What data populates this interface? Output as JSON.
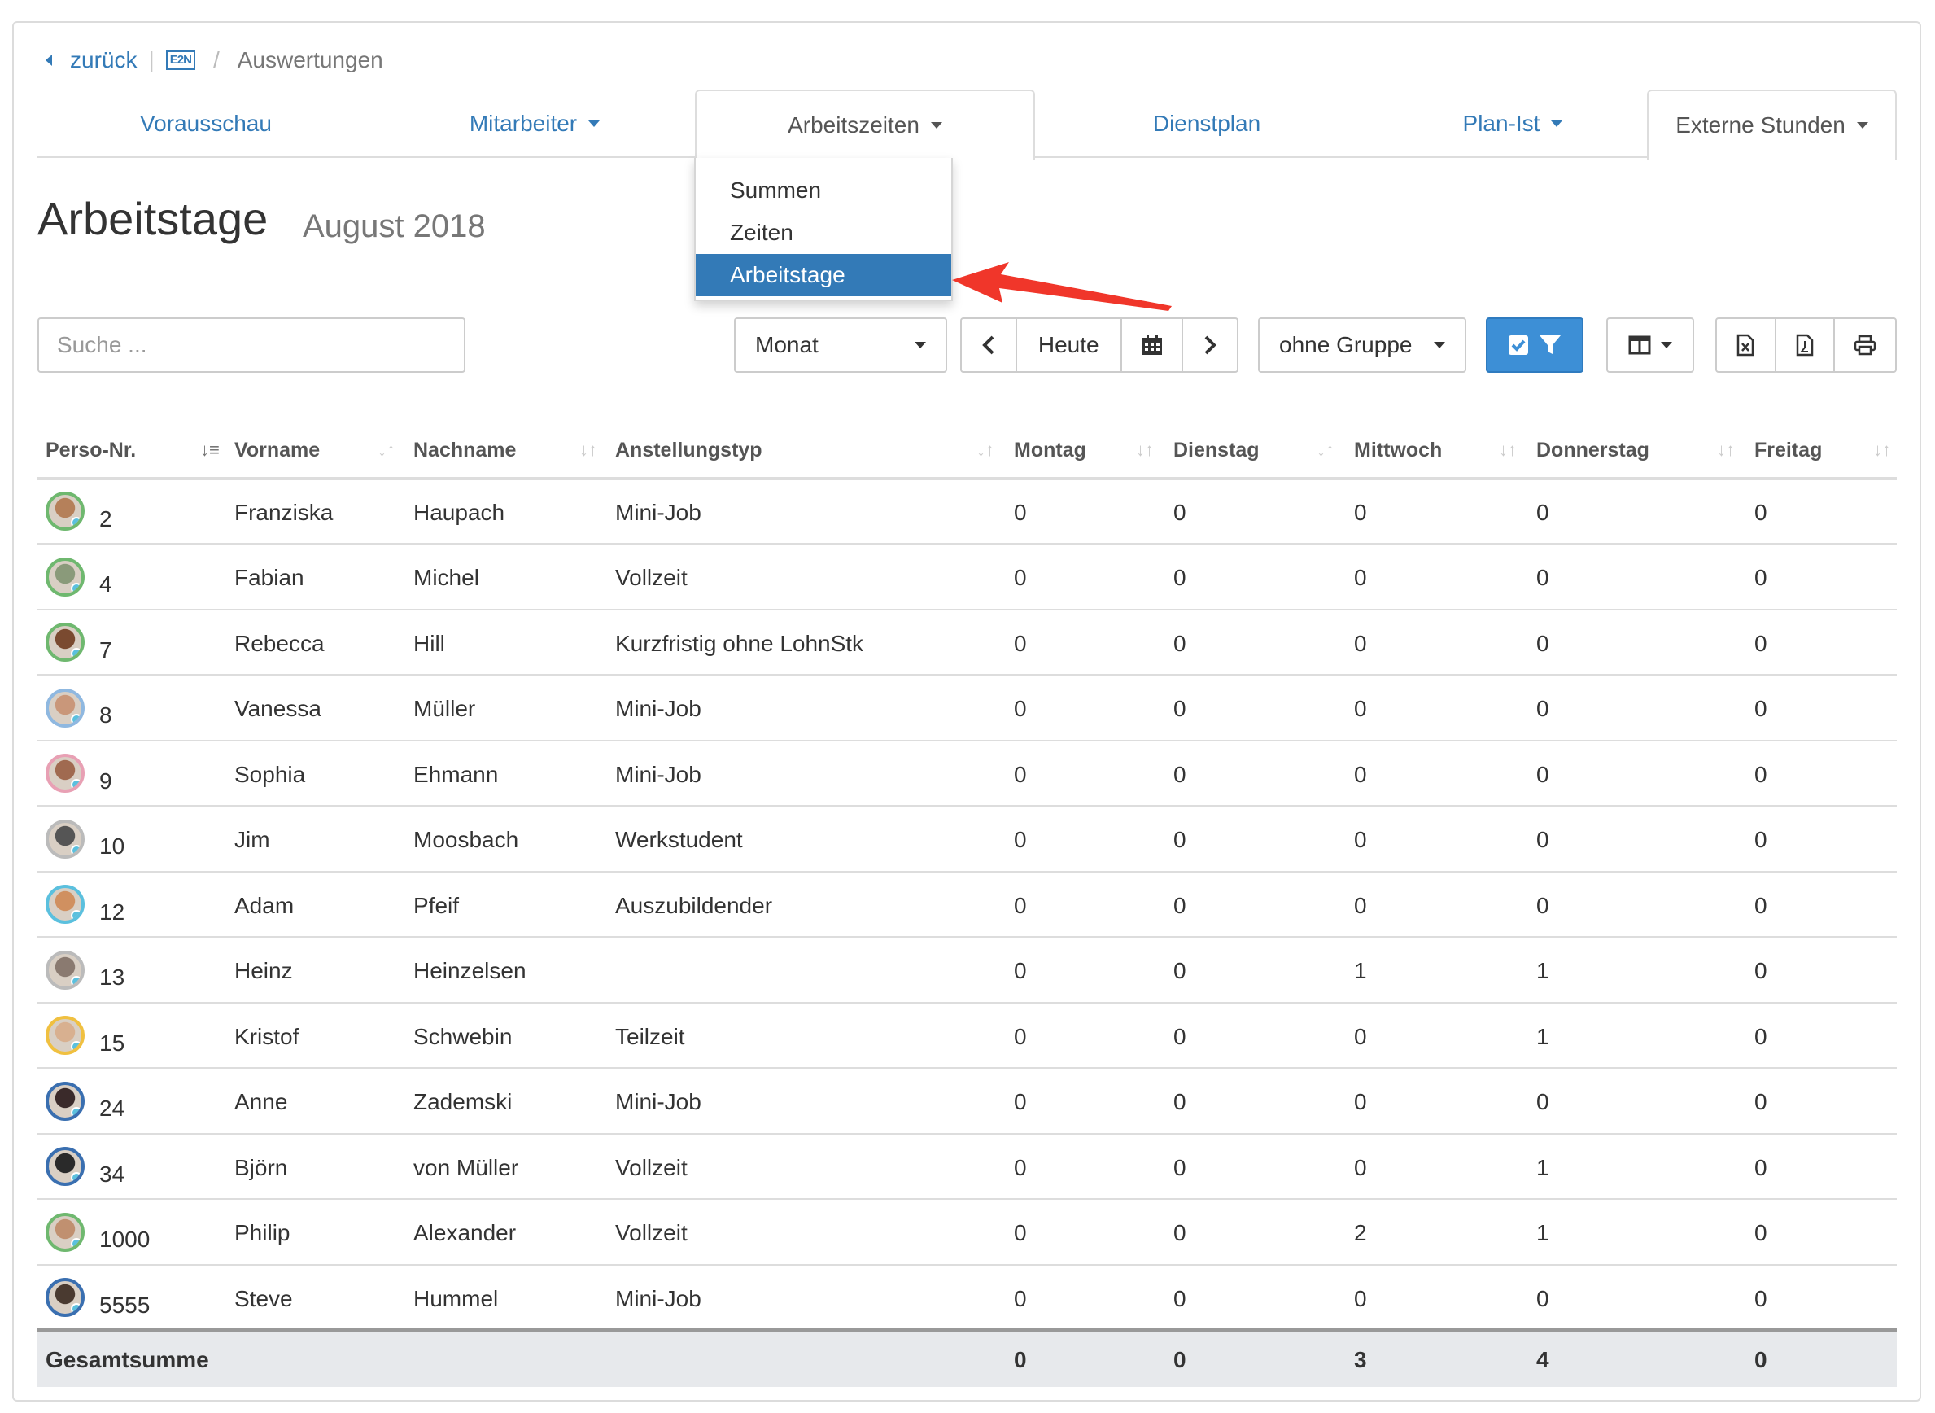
{
  "breadcrumb": {
    "back": "zurück",
    "logo": "E2N",
    "current": "Auswertungen"
  },
  "tabs": [
    {
      "label": "Vorausschau",
      "dropdown": false
    },
    {
      "label": "Mitarbeiter",
      "dropdown": true
    },
    {
      "label": "Arbeitszeiten",
      "dropdown": true
    },
    {
      "label": "Dienstplan",
      "dropdown": false
    },
    {
      "label": "Plan-Ist",
      "dropdown": true
    },
    {
      "label": "Externe Stunden",
      "dropdown": true
    }
  ],
  "menu": {
    "items": [
      "Summen",
      "Zeiten",
      "Arbeitstage"
    ],
    "active": "Arbeitstage"
  },
  "page": {
    "title": "Arbeitstage",
    "subtitle": "August 2018"
  },
  "controls": {
    "search_placeholder": "Suche ...",
    "period": "Monat",
    "today": "Heute",
    "group": "ohne Gruppe"
  },
  "colors": {
    "accent": "#337ab7",
    "primary_button": "#3d8fd6",
    "arrow": "#f0362a"
  },
  "table": {
    "headers": [
      "Perso-Nr.",
      "Vorname",
      "Nachname",
      "Anstellungstyp",
      "Montag",
      "Dienstag",
      "Mittwoch",
      "Donnerstag",
      "Freitag"
    ],
    "rows": [
      {
        "nr": "2",
        "vorname": "Franziska",
        "nachname": "Haupach",
        "typ": "Mini-Job",
        "mo": "0",
        "di": "0",
        "mi": "0",
        "do": "0",
        "fr": "0",
        "ring": "#6fb86f",
        "face": "#b5805a"
      },
      {
        "nr": "4",
        "vorname": "Fabian",
        "nachname": "Michel",
        "typ": "Vollzeit",
        "mo": "0",
        "di": "0",
        "mi": "0",
        "do": "0",
        "fr": "0",
        "ring": "#6fb86f",
        "face": "#8a9a7a"
      },
      {
        "nr": "7",
        "vorname": "Rebecca",
        "nachname": "Hill",
        "typ": "Kurzfristig ohne LohnStk",
        "mo": "0",
        "di": "0",
        "mi": "0",
        "do": "0",
        "fr": "0",
        "ring": "#6fb86f",
        "face": "#7a4a30"
      },
      {
        "nr": "8",
        "vorname": "Vanessa",
        "nachname": "Müller",
        "typ": "Mini-Job",
        "mo": "0",
        "di": "0",
        "mi": "0",
        "do": "0",
        "fr": "0",
        "ring": "#8fb8e0",
        "face": "#c9977a"
      },
      {
        "nr": "9",
        "vorname": "Sophia",
        "nachname": "Ehmann",
        "typ": "Mini-Job",
        "mo": "0",
        "di": "0",
        "mi": "0",
        "do": "0",
        "fr": "0",
        "ring": "#e8a0b4",
        "face": "#a06a50"
      },
      {
        "nr": "10",
        "vorname": "Jim",
        "nachname": "Moosbach",
        "typ": "Werkstudent",
        "mo": "0",
        "di": "0",
        "mi": "0",
        "do": "0",
        "fr": "0",
        "ring": "#bbbbbb",
        "face": "#555555"
      },
      {
        "nr": "12",
        "vorname": "Adam",
        "nachname": "Pfeif",
        "typ": "Auszubildender",
        "mo": "0",
        "di": "0",
        "mi": "0",
        "do": "0",
        "fr": "0",
        "ring": "#5bc0de",
        "face": "#d09060"
      },
      {
        "nr": "13",
        "vorname": "Heinz",
        "nachname": "Heinzelsen",
        "typ": "",
        "mo": "0",
        "di": "0",
        "mi": "1",
        "do": "1",
        "fr": "0",
        "ring": "#bbbbbb",
        "face": "#8a7a70"
      },
      {
        "nr": "15",
        "vorname": "Kristof",
        "nachname": "Schwebin",
        "typ": "Teilzeit",
        "mo": "0",
        "di": "0",
        "mi": "0",
        "do": "1",
        "fr": "0",
        "ring": "#f0c040",
        "face": "#d8b090"
      },
      {
        "nr": "24",
        "vorname": "Anne",
        "nachname": "Zademski",
        "typ": "Mini-Job",
        "mo": "0",
        "di": "0",
        "mi": "0",
        "do": "0",
        "fr": "0",
        "ring": "#3a6fb0",
        "face": "#3a2a2a"
      },
      {
        "nr": "34",
        "vorname": "Björn",
        "nachname": "von Müller",
        "typ": "Vollzeit",
        "mo": "0",
        "di": "0",
        "mi": "0",
        "do": "1",
        "fr": "0",
        "ring": "#3a6fb0",
        "face": "#2a2a2a"
      },
      {
        "nr": "1000",
        "vorname": "Philip",
        "nachname": "Alexander",
        "typ": "Vollzeit",
        "mo": "0",
        "di": "0",
        "mi": "2",
        "do": "1",
        "fr": "0",
        "ring": "#6fb86f",
        "face": "#c09070"
      },
      {
        "nr": "5555",
        "vorname": "Steve",
        "nachname": "Hummel",
        "typ": "Mini-Job",
        "mo": "0",
        "di": "0",
        "mi": "0",
        "do": "0",
        "fr": "0",
        "ring": "#3a6fb0",
        "face": "#4a3a30"
      }
    ],
    "total": {
      "label": "Gesamtsumme",
      "mo": "0",
      "di": "0",
      "mi": "3",
      "do": "4",
      "fr": "0"
    }
  }
}
